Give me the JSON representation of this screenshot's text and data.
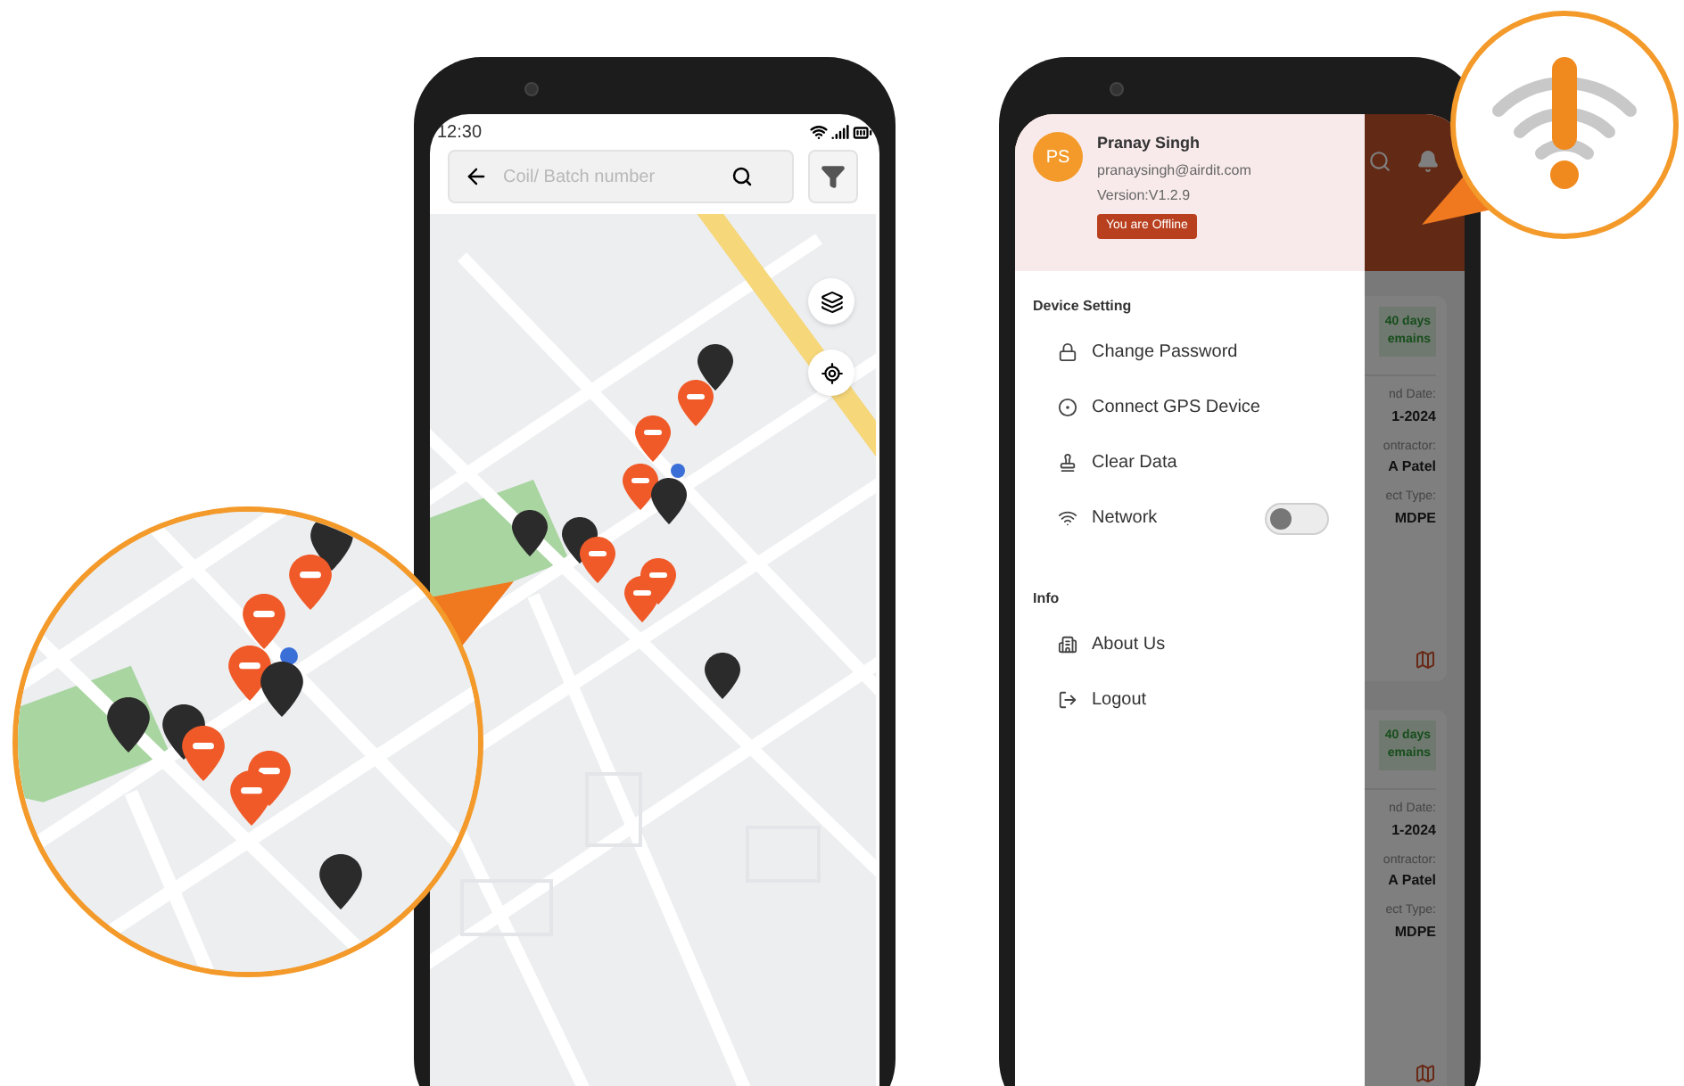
{
  "map_screen": {
    "status_time": "12:30",
    "search": {
      "placeholder": "Coil/ Batch number"
    },
    "pins": [
      {
        "kind": "point"
      },
      {
        "kind": "task"
      },
      {
        "kind": "task"
      },
      {
        "kind": "task"
      },
      {
        "kind": "point"
      },
      {
        "kind": "point"
      },
      {
        "kind": "point"
      },
      {
        "kind": "task"
      },
      {
        "kind": "task"
      },
      {
        "kind": "task"
      },
      {
        "kind": "point"
      }
    ]
  },
  "menu_screen": {
    "profile": {
      "initials": "PS",
      "name": "Pranay Singh",
      "email": "pranaysingh@airdit.com",
      "version": "Version:V1.2.9",
      "status_badge": "You are Offline"
    },
    "sections": [
      {
        "title": "Device Setting",
        "items": [
          {
            "kind": "link",
            "label": "Change Password"
          },
          {
            "kind": "link",
            "label": "Connect GPS Device"
          },
          {
            "kind": "link",
            "label": "Clear Data"
          },
          {
            "kind": "toggle",
            "label": "Network",
            "on": false
          }
        ]
      },
      {
        "title": "Info",
        "items": [
          {
            "kind": "link",
            "label": "About Us"
          },
          {
            "kind": "link",
            "label": "Logout"
          }
        ]
      }
    ],
    "background_cards": [
      {
        "badge_lines": [
          "40 days",
          "emains"
        ],
        "rows": [
          {
            "label": "nd Date:",
            "value": "1-2024"
          },
          {
            "label": "ontractor:",
            "value": "A Patel"
          },
          {
            "label": "ect Type:",
            "value": "MDPE"
          }
        ]
      },
      {
        "badge_lines": [
          "40 days",
          "emains"
        ],
        "rows": [
          {
            "label": "nd Date:",
            "value": "1-2024"
          },
          {
            "label": "ontractor:",
            "value": "A Patel"
          },
          {
            "label": "ect Type:",
            "value": "MDPE"
          }
        ]
      }
    ]
  }
}
